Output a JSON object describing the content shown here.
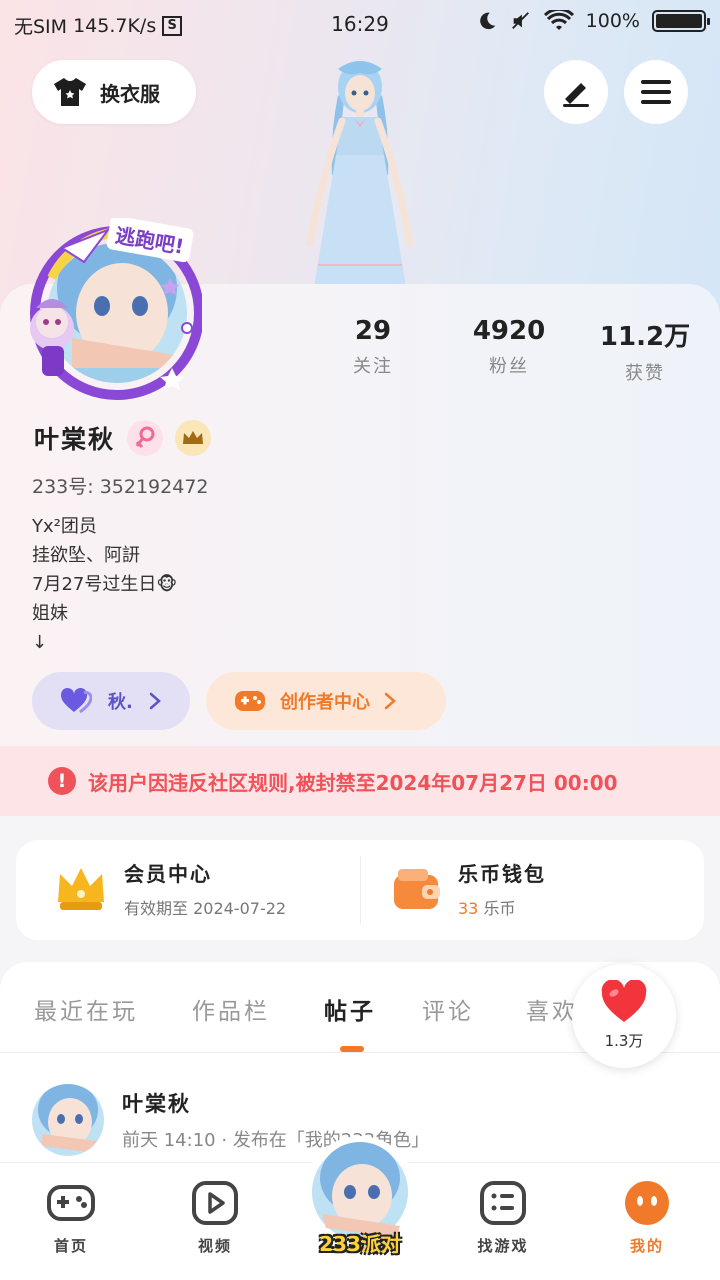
{
  "status_bar": {
    "sim": "无SIM",
    "speed": "145.7K/s",
    "s_icon": "S",
    "time": "16:29",
    "battery": "100%"
  },
  "top": {
    "outfit_label": "换衣服",
    "icons": [
      "tshirt-icon",
      "pencil-icon",
      "menu-icon"
    ]
  },
  "avatar_frame": {
    "banner_text": "逃跑吧!"
  },
  "stats": [
    {
      "num": "29",
      "label": "关注"
    },
    {
      "num": "4920",
      "label": "粉丝"
    },
    {
      "num": "11.2万",
      "label": "获赞"
    }
  ],
  "profile": {
    "name": "叶棠秋",
    "uid": "233号: 352192472",
    "bio": [
      "Yx²团员",
      "挂欲坠、阿訮",
      "7月27号过生日🐵",
      "姐妹",
      "↓"
    ]
  },
  "pills": {
    "friend": "秋.",
    "creator": "创作者中心"
  },
  "ban_notice": "该用户因违反社区规则,被封禁至2024年07月27日 00:00",
  "vip": {
    "title": "会员中心",
    "sub": "有效期至 2024-07-22",
    "wallet_title": "乐币钱包",
    "wallet_amount": "33",
    "wallet_unit": "乐币"
  },
  "tabs": [
    "最近在玩",
    "作品栏",
    "帖子",
    "评论",
    "喜欢"
  ],
  "active_tab": "帖子",
  "like_float": {
    "count": "1.3万"
  },
  "post": {
    "author": "叶棠秋",
    "meta": "前天 14:10 · 发布在「我的233角色」"
  },
  "bottom_nav": {
    "items": [
      {
        "label": "首页",
        "icon": "gamepad-icon"
      },
      {
        "label": "视频",
        "icon": "play-icon"
      },
      {
        "label": "找游戏",
        "icon": "list-icon"
      },
      {
        "label": "我的",
        "icon": "face-icon"
      }
    ],
    "center_label": "233派对"
  },
  "colors": {
    "accent": "#f07a2a",
    "ban": "#f0525a",
    "friend": "#5b54c4"
  }
}
